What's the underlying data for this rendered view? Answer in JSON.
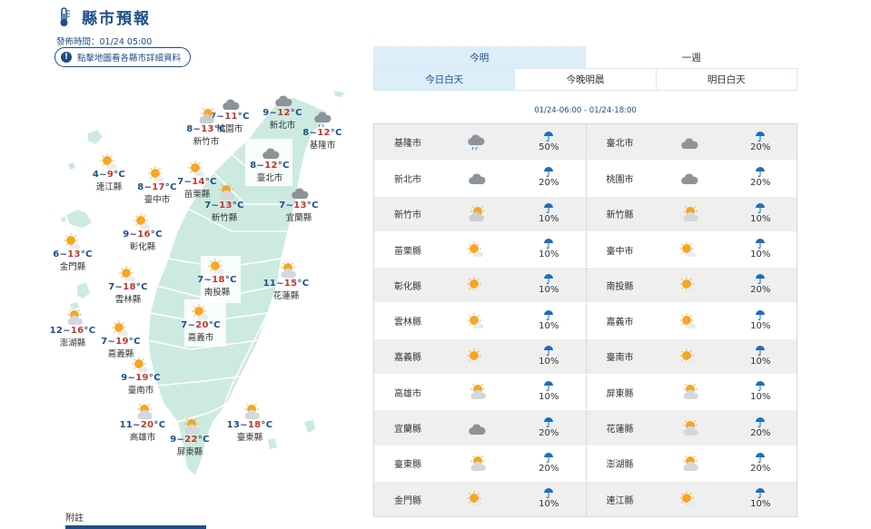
{
  "header": {
    "title": "縣市預報",
    "pub_time": "發佈時間：01/24 05:00",
    "hint": "點擊地圖看各縣市詳細資料"
  },
  "map_cities": [
    {
      "id": "keelung",
      "name": "基隆市",
      "temp_lo": "8",
      "temp_hi": "12",
      "unit": "°C",
      "icon": "cloud-rain-icon"
    },
    {
      "id": "newtaipei",
      "name": "新北市",
      "temp_lo": "9",
      "temp_hi": "12",
      "unit": "°C",
      "icon": "cloudy-icon"
    },
    {
      "id": "taipei",
      "name": "臺北市",
      "temp_lo": "8",
      "temp_hi": "12",
      "unit": "°C",
      "icon": "cloudy-icon"
    },
    {
      "id": "taoyuan",
      "name": "桃園市",
      "temp_lo": "7",
      "temp_hi": "11",
      "unit": "°C",
      "icon": "cloudy-icon"
    },
    {
      "id": "hsinchucity",
      "name": "新竹市",
      "temp_lo": "8",
      "temp_hi": "13",
      "unit": "°C",
      "icon": "partly-sunny-icon"
    },
    {
      "id": "hsinchucounty",
      "name": "新竹縣",
      "temp_lo": "7",
      "temp_hi": "13",
      "unit": "°C",
      "icon": "partly-cloudy-icon"
    },
    {
      "id": "miaoli",
      "name": "苗栗縣",
      "temp_lo": "7",
      "temp_hi": "14",
      "unit": "°C",
      "icon": "sunny-icon"
    },
    {
      "id": "taichung",
      "name": "臺中市",
      "temp_lo": "8",
      "temp_hi": "17",
      "unit": "°C",
      "icon": "sunny-icon"
    },
    {
      "id": "yilan",
      "name": "宜蘭縣",
      "temp_lo": "7",
      "temp_hi": "13",
      "unit": "°C",
      "icon": "cloudy-icon"
    },
    {
      "id": "lienchiang",
      "name": "連江縣",
      "temp_lo": "4",
      "temp_hi": "9",
      "unit": "°C",
      "icon": "sunny-icon"
    },
    {
      "id": "changhua",
      "name": "彰化縣",
      "temp_lo": "9",
      "temp_hi": "16",
      "unit": "°C",
      "icon": "sunny-icon"
    },
    {
      "id": "kinmen",
      "name": "金門縣",
      "temp_lo": "6",
      "temp_hi": "13",
      "unit": "°C",
      "icon": "sunny-icon"
    },
    {
      "id": "nantou",
      "name": "南投縣",
      "temp_lo": "7",
      "temp_hi": "18",
      "unit": "°C",
      "icon": "sunny-icon"
    },
    {
      "id": "hualien",
      "name": "花蓮縣",
      "temp_lo": "11",
      "temp_hi": "15",
      "unit": "°C",
      "icon": "partly-cloudy-icon"
    },
    {
      "id": "yunlin",
      "name": "雲林縣",
      "temp_lo": "7",
      "temp_hi": "18",
      "unit": "°C",
      "icon": "sunny-icon"
    },
    {
      "id": "chiayicity",
      "name": "嘉義市",
      "temp_lo": "7",
      "temp_hi": "20",
      "unit": "°C",
      "icon": "sunny-icon"
    },
    {
      "id": "chiayicounty",
      "name": "嘉義縣",
      "temp_lo": "7",
      "temp_hi": "19",
      "unit": "°C",
      "icon": "sunny-icon"
    },
    {
      "id": "penghu",
      "name": "澎湖縣",
      "temp_lo": "12",
      "temp_hi": "16",
      "unit": "°C",
      "icon": "partly-cloudy-icon"
    },
    {
      "id": "tainan",
      "name": "臺南市",
      "temp_lo": "9",
      "temp_hi": "19",
      "unit": "°C",
      "icon": "sunny-icon"
    },
    {
      "id": "kaohsiung",
      "name": "高雄市",
      "temp_lo": "11",
      "temp_hi": "20",
      "unit": "°C",
      "icon": "partly-cloudy-icon"
    },
    {
      "id": "taitung",
      "name": "臺東縣",
      "temp_lo": "13",
      "temp_hi": "18",
      "unit": "°C",
      "icon": "partly-cloudy-icon"
    },
    {
      "id": "pingtung",
      "name": "屏東縣",
      "temp_lo": "9",
      "temp_hi": "22",
      "unit": "°C",
      "icon": "partly-cloudy-icon"
    }
  ],
  "tabs_primary": [
    {
      "label": "今明",
      "active": true
    },
    {
      "label": "一週",
      "active": false
    }
  ],
  "tabs_secondary": [
    {
      "label": "今日白天",
      "active": true
    },
    {
      "label": "今晚明晨",
      "active": false
    },
    {
      "label": "明日白天",
      "active": false
    }
  ],
  "period": "01/24-06:00 - 01/24-18:00",
  "rows": [
    [
      {
        "name": "基隆市",
        "icon": "cloud-rain-icon",
        "rain": "50%"
      },
      {
        "name": "臺北市",
        "icon": "cloudy-icon",
        "rain": "20%"
      }
    ],
    [
      {
        "name": "新北市",
        "icon": "cloudy-icon",
        "rain": "20%"
      },
      {
        "name": "桃園市",
        "icon": "cloudy-icon",
        "rain": "20%"
      }
    ],
    [
      {
        "name": "新竹市",
        "icon": "partly-sunny-icon",
        "rain": "10%"
      },
      {
        "name": "新竹縣",
        "icon": "partly-cloudy-icon",
        "rain": "10%"
      }
    ],
    [
      {
        "name": "苗栗縣",
        "icon": "sunny-icon",
        "rain": "10%"
      },
      {
        "name": "臺中市",
        "icon": "sunny-icon",
        "rain": "10%"
      }
    ],
    [
      {
        "name": "彰化縣",
        "icon": "sunny-icon",
        "rain": "10%"
      },
      {
        "name": "南投縣",
        "icon": "sunny-icon",
        "rain": "20%"
      }
    ],
    [
      {
        "name": "雲林縣",
        "icon": "sunny-icon",
        "rain": "10%"
      },
      {
        "name": "嘉義市",
        "icon": "sunny-icon",
        "rain": "10%"
      }
    ],
    [
      {
        "name": "嘉義縣",
        "icon": "sunny-icon",
        "rain": "10%"
      },
      {
        "name": "臺南市",
        "icon": "sunny-icon",
        "rain": "10%"
      }
    ],
    [
      {
        "name": "高雄市",
        "icon": "partly-cloudy-icon",
        "rain": "10%"
      },
      {
        "name": "屏東縣",
        "icon": "partly-cloudy-icon",
        "rain": "10%"
      }
    ],
    [
      {
        "name": "宜蘭縣",
        "icon": "cloudy-icon",
        "rain": "20%"
      },
      {
        "name": "花蓮縣",
        "icon": "partly-cloudy-icon",
        "rain": "20%"
      }
    ],
    [
      {
        "name": "臺東縣",
        "icon": "partly-cloudy-icon",
        "rain": "20%"
      },
      {
        "name": "澎湖縣",
        "icon": "partly-cloudy-icon",
        "rain": "20%"
      }
    ],
    [
      {
        "name": "金門縣",
        "icon": "sunny-icon",
        "rain": "10%"
      },
      {
        "name": "連江縣",
        "icon": "sunny-icon",
        "rain": "10%"
      }
    ]
  ],
  "footnote": "附註",
  "colors": {
    "brand": "#1d4e89",
    "map_land": "#cdeae0",
    "map_border": "#ffffff",
    "highlight_tab": "#dbeefa",
    "row_shade": "#efefef",
    "temp_hi": "#c0392b"
  }
}
